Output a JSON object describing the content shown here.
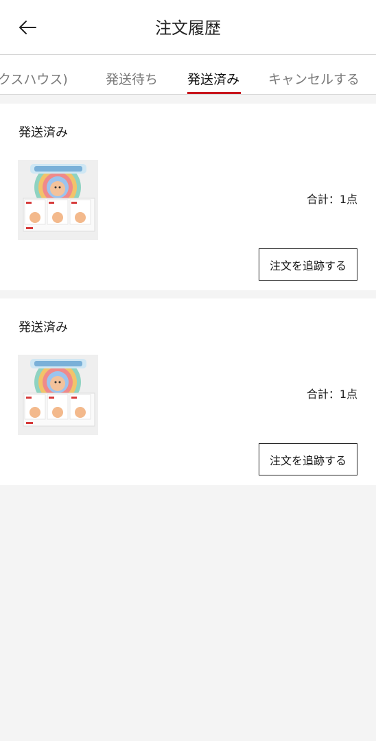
{
  "header": {
    "title": "注文履歴",
    "back_icon": "arrow-left-icon"
  },
  "tabs": [
    {
      "label": "クスハウス)",
      "active": false
    },
    {
      "label": "発送待ち",
      "active": false
    },
    {
      "label": "発送済み",
      "active": true
    },
    {
      "label": "キャンセルする",
      "active": false
    }
  ],
  "orders": [
    {
      "status": "発送済み",
      "total": "合計：1点",
      "action_label": "注文を追跡する",
      "thumbnail_icon": "product-box-image"
    },
    {
      "status": "発送済み",
      "total": "合計：1点",
      "action_label": "注文を追跡する",
      "thumbnail_icon": "product-box-image"
    }
  ],
  "colors": {
    "accent": "#c8161d",
    "background": "#f4f4f4"
  }
}
